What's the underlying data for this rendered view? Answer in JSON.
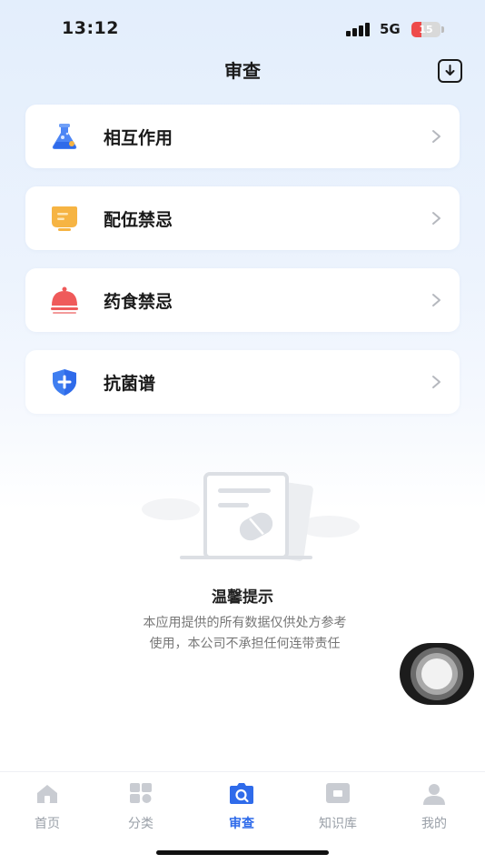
{
  "status_bar": {
    "time": "13:12",
    "network": "5G",
    "battery": "15",
    "battery_level": 0.15,
    "icons": [
      "cellular-signal-icon",
      "battery-charging-icon"
    ]
  },
  "header": {
    "title": "审查",
    "action_icon": "download-icon"
  },
  "menu": [
    {
      "label": "相互作用",
      "icon": "flask-icon",
      "color": "#4d86f5"
    },
    {
      "label": "配伍禁忌",
      "icon": "label-tag-icon",
      "color": "#f6b443"
    },
    {
      "label": "药食禁忌",
      "icon": "food-cloche-icon",
      "color": "#ef5a5a"
    },
    {
      "label": "抗菌谱",
      "icon": "shield-plus-icon",
      "color": "#3f7ef0"
    }
  ],
  "notice": {
    "title": "温馨提示",
    "lines": [
      "本应用提供的所有数据仅供处方参考",
      "使用，本公司不承担任何连带责任"
    ]
  },
  "tabs": [
    {
      "label": "首页",
      "icon": "home-icon",
      "active": false
    },
    {
      "label": "分类",
      "icon": "category-grid-icon",
      "active": false
    },
    {
      "label": "审查",
      "icon": "review-camera-icon",
      "active": true
    },
    {
      "label": "知识库",
      "icon": "knowledge-book-icon",
      "active": false
    },
    {
      "label": "我的",
      "icon": "user-profile-icon",
      "active": false
    }
  ],
  "colors": {
    "accent": "#2f6bea",
    "inactive": "#9aa0a8",
    "background_top": "#e3eefc"
  }
}
